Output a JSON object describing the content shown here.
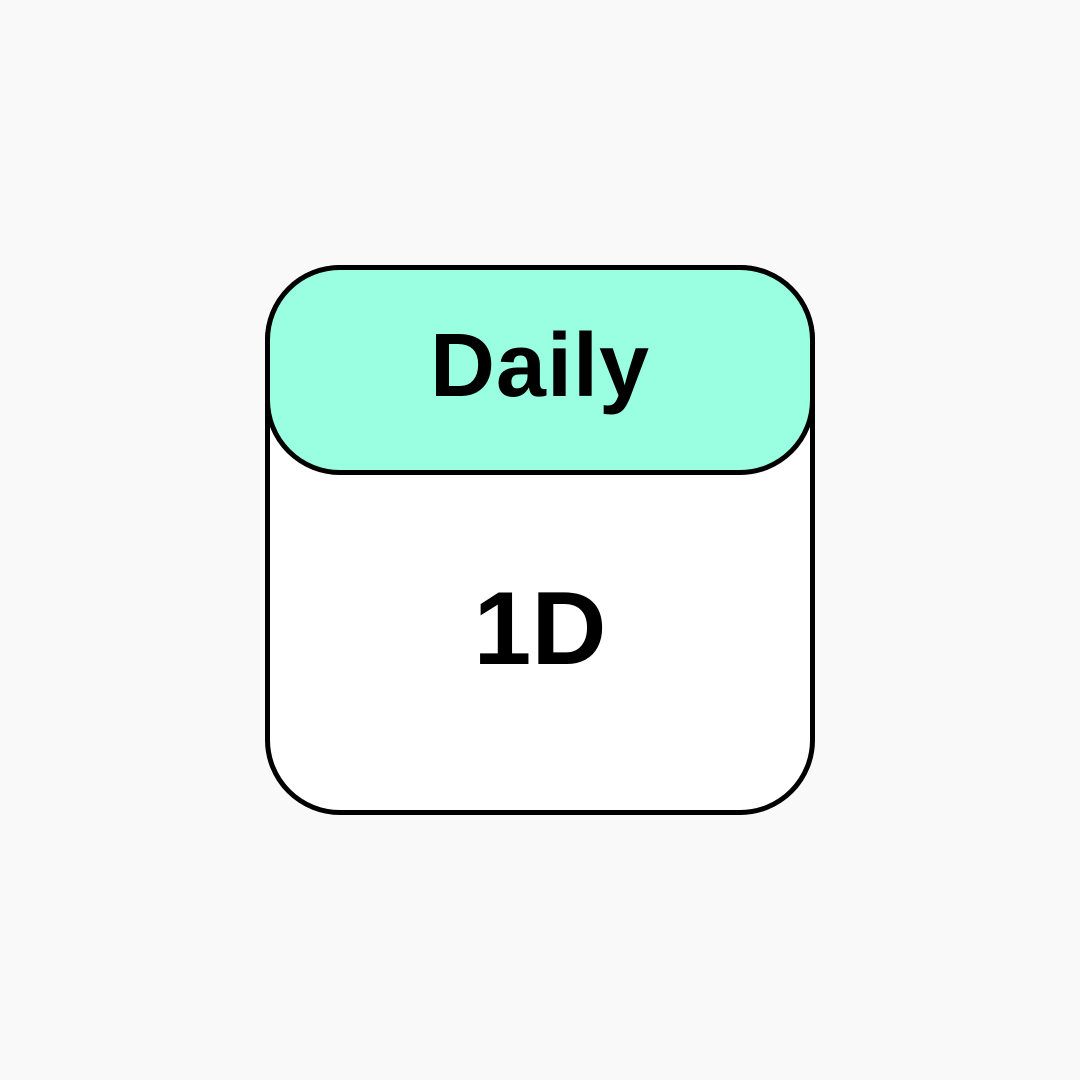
{
  "card": {
    "title": "Daily",
    "value": "1D"
  },
  "colors": {
    "background": "#f9f9f9",
    "header_fill": "#9afee0",
    "body_fill": "#ffffff",
    "outline": "#000000"
  }
}
